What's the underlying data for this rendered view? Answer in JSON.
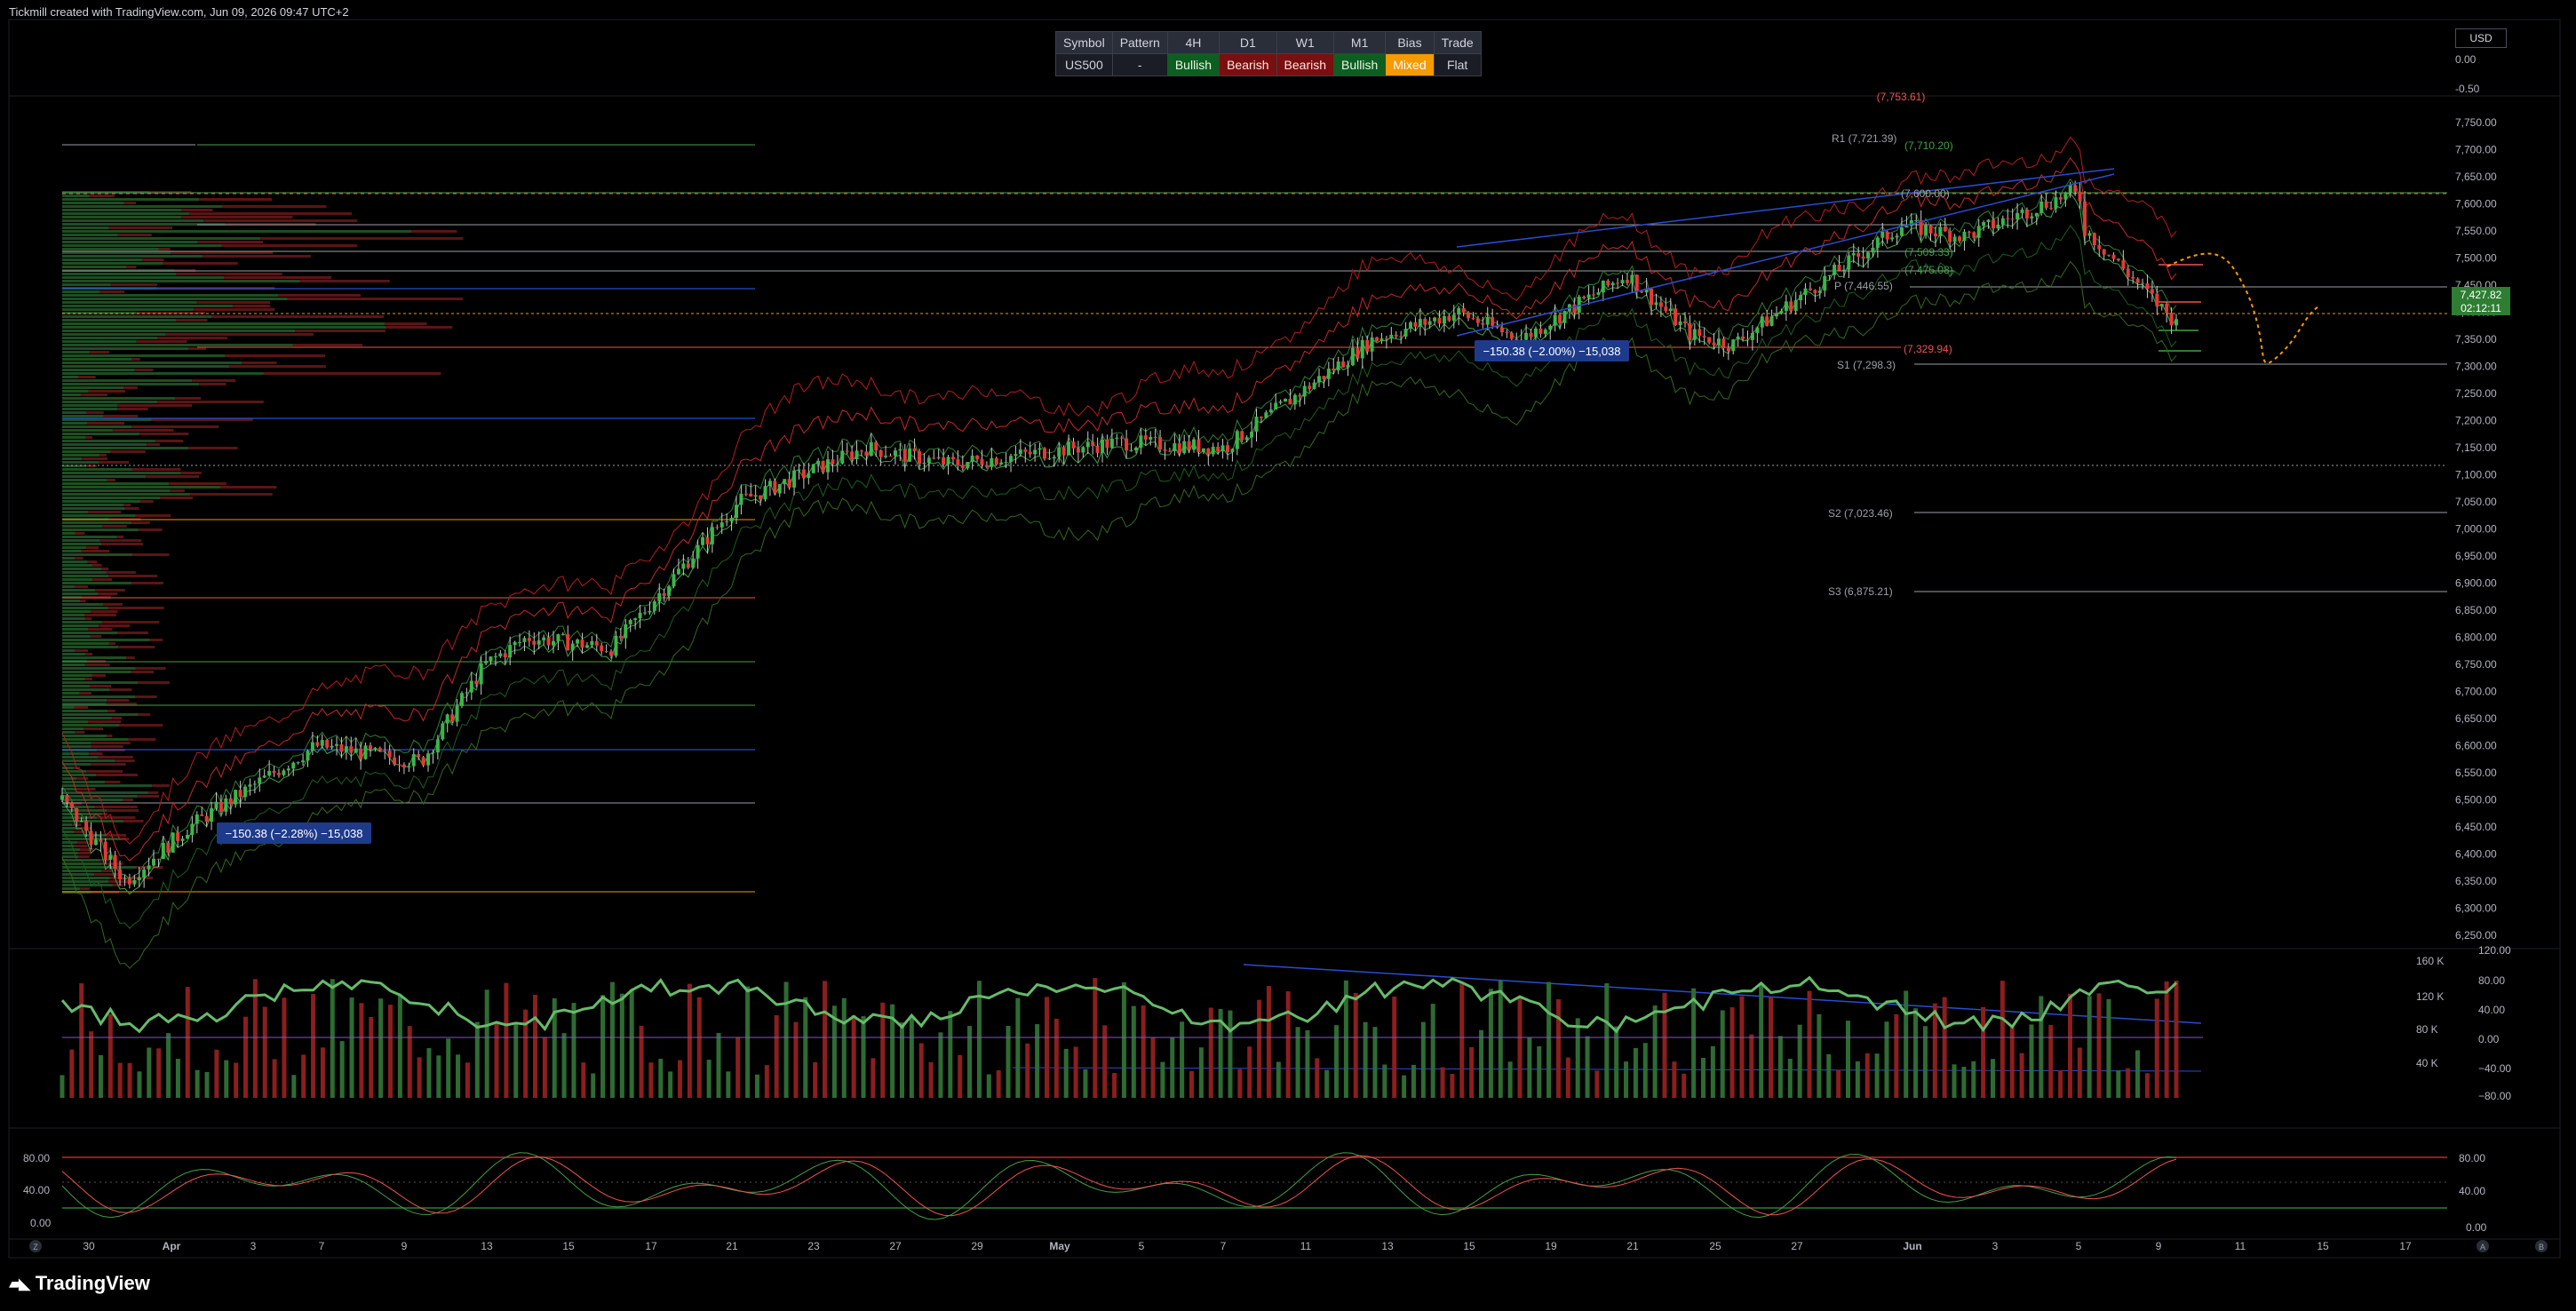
{
  "header": {
    "text": "Tickmill created with TradingView.com, Jun 09, 2026 09:47 UTC+2"
  },
  "summary": {
    "headers": [
      "Symbol",
      "Pattern",
      "4H",
      "D1",
      "W1",
      "M1",
      "Bias",
      "Trade"
    ],
    "values": [
      "US500",
      "-",
      "Bullish",
      "Bearish",
      "Bearish",
      "Bullish",
      "Mixed",
      "Flat"
    ]
  },
  "currency": "USD",
  "colors": {
    "bull": "#26a69a",
    "bear": "#ef5350",
    "green_candle": "#3bb54a",
    "red_candle": "#e53935",
    "orange": "#f59a00",
    "blue": "#2962ff"
  },
  "main_scale": {
    "labels": [
      "7,750.00",
      "7,700.00",
      "7,650.00",
      "7,600.00",
      "7,550.00",
      "7,500.00",
      "7,450.00",
      "7,400.00",
      "7,350.00",
      "7,300.00",
      "7,250.00",
      "7,200.00",
      "7,150.00",
      "7,100.00",
      "7,050.00",
      "7,000.00",
      "6,950.00",
      "6,900.00",
      "6,850.00",
      "6,800.00",
      "6,750.00",
      "6,700.00",
      "6,650.00",
      "6,600.00",
      "6,550.00",
      "6,500.00",
      "6,450.00",
      "6,400.00",
      "6,350.00",
      "6,300.00",
      "6,250.00"
    ],
    "top_labels": [
      "0.00",
      "-0.50"
    ],
    "price_badge": "7,427.82",
    "countdown": "02:12:11"
  },
  "pivots": {
    "r1": "R1 (7,721.39)",
    "r1b": "(7,710.20)",
    "top_red": "(7,753.61)",
    "v7600": "(7,600.00)",
    "v7509": "(7,509.33)",
    "v7475": "(7,475.08)",
    "p": "P (7,446.55)",
    "v7329": "(7,329.94)",
    "s1": "S1 (7,298.3)",
    "s2": "S2 (7,023.46)",
    "s3": "S3 (6,875.21)"
  },
  "measure": {
    "left": "−150.38 (−2.28%) −15,038",
    "right": "−150.38 (−2.00%) −15,038"
  },
  "volume_scale": {
    "left_labels": [
      "160 K",
      "120 K",
      "80 K",
      "40 K"
    ],
    "right_labels": [
      "120.00",
      "80.00",
      "40.00",
      "0.00",
      "−40.00",
      "−80.00"
    ]
  },
  "stoch_scale": {
    "left_labels": [
      "80.00",
      "40.00",
      "0.00"
    ],
    "right_labels": [
      "80.00",
      "40.00",
      "0.00"
    ]
  },
  "time_axis": [
    "30",
    "Apr",
    "3",
    "7",
    "9",
    "13",
    "15",
    "17",
    "21",
    "23",
    "27",
    "29",
    "May",
    "5",
    "7",
    "11",
    "13",
    "15",
    "19",
    "21",
    "25",
    "27",
    "Jun",
    "3",
    "5",
    "9",
    "11",
    "15",
    "17"
  ],
  "brand": "TradingView"
}
